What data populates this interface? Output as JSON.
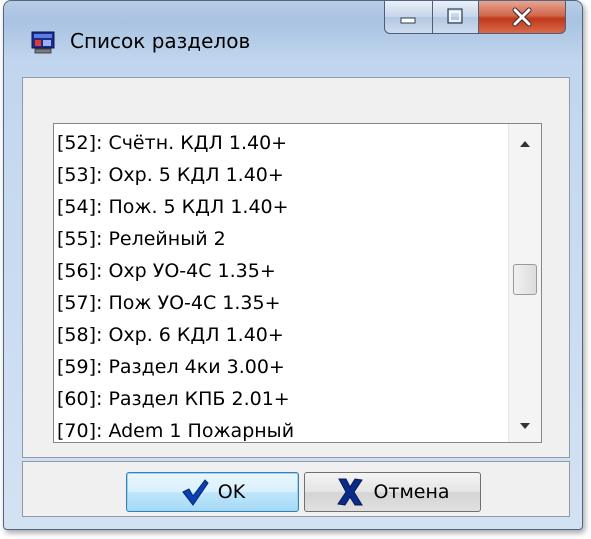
{
  "window": {
    "title": "Список разделов",
    "icon": "app-window-icon"
  },
  "caption_buttons": {
    "minimize_icon": "minimize-icon",
    "maximize_icon": "maximize-icon",
    "close_icon": "close-icon"
  },
  "list": {
    "items": [
      {
        "label": "[52]: Счётн. КДЛ 1.40+"
      },
      {
        "label": "[53]: Охр. 5 КДЛ 1.40+"
      },
      {
        "label": "[54]: Пож. 5 КДЛ 1.40+"
      },
      {
        "label": "[55]: Релейный 2"
      },
      {
        "label": "[56]: Охр УО-4С 1.35+"
      },
      {
        "label": "[57]: Пож УО-4С 1.35+"
      },
      {
        "label": "[58]: Охр. 6 КДЛ 1.40+"
      },
      {
        "label": "[59]: Раздел 4ки 3.00+"
      },
      {
        "label": "[60]: Раздел КПБ 2.01+"
      },
      {
        "label": "[70]: Adem 1 Пожарный"
      }
    ]
  },
  "buttons": {
    "ok_label": "OK",
    "cancel_label": "Отмена",
    "ok_icon": "checkmark-icon",
    "cancel_icon": "cross-icon"
  },
  "colors": {
    "ok_check": "#0b3fb3",
    "cancel_cross": "#0a2b8a",
    "close_button": "#c8412a"
  }
}
